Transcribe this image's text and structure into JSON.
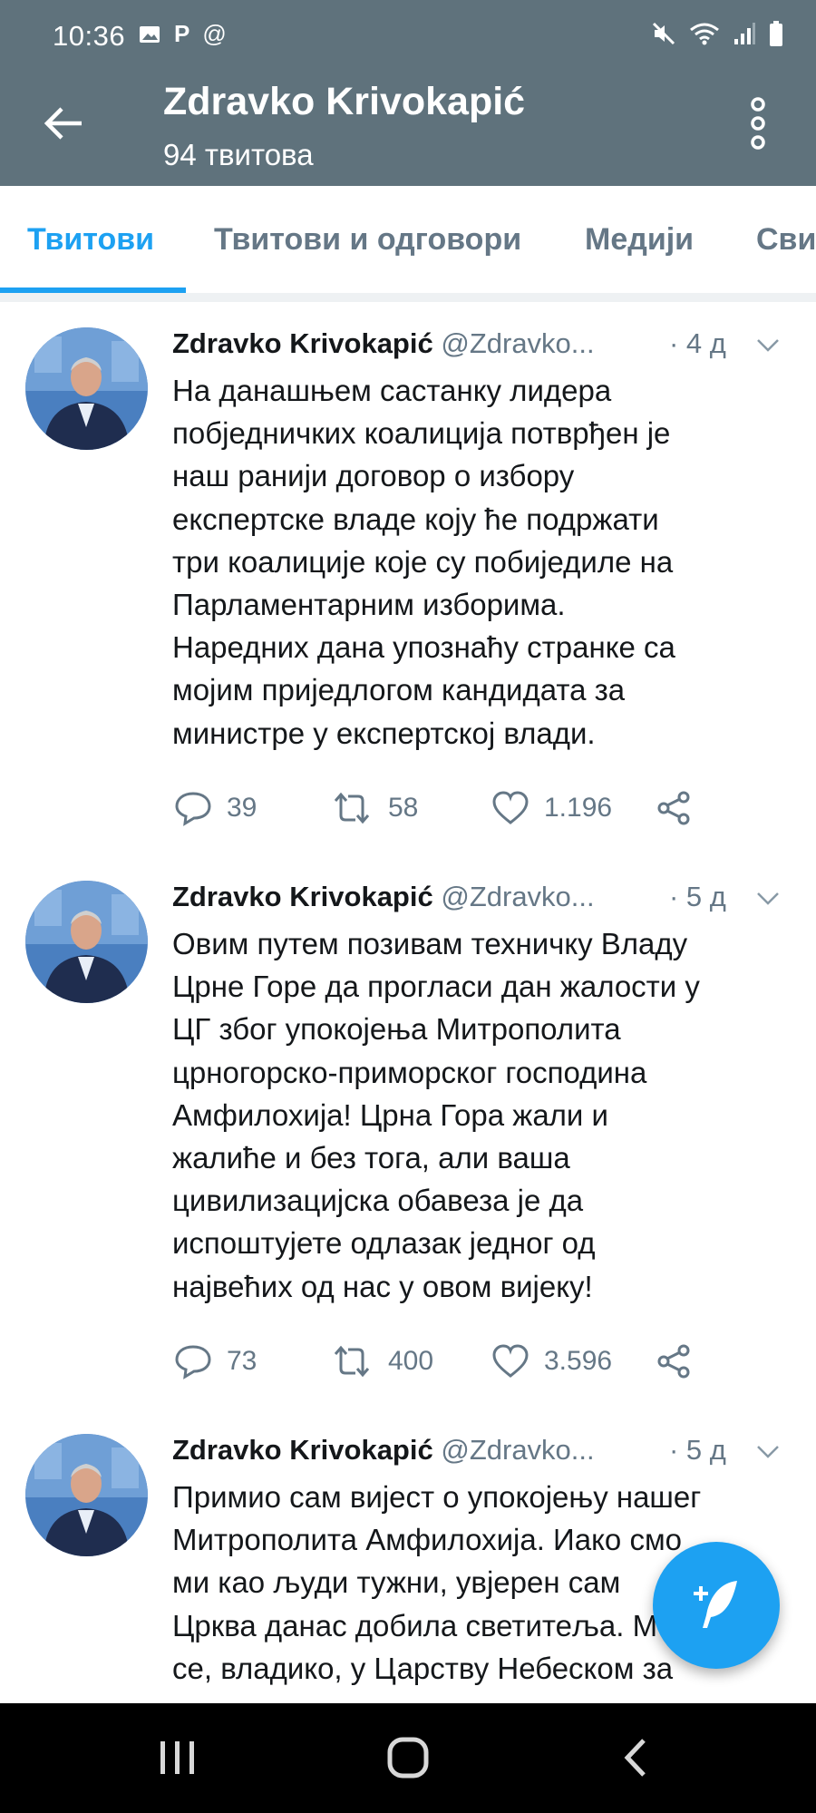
{
  "status_bar": {
    "time": "10:36",
    "left_icons": [
      "image-icon",
      "p-icon",
      "at-icon"
    ],
    "right_icons": [
      "mute-icon",
      "wifi-icon",
      "signal-icon",
      "battery-icon"
    ]
  },
  "header": {
    "title": "Zdravko Krivokapić",
    "subtitle": "94 твитова",
    "background_color": "#5f727c"
  },
  "tabs": [
    {
      "label": "Твитови",
      "active": true
    },
    {
      "label": "Твитови и одговори",
      "active": false
    },
    {
      "label": "Медији",
      "active": false
    },
    {
      "label": "Сви",
      "active": false
    }
  ],
  "accent_color": "#1da1f2",
  "tweets": [
    {
      "name": "Zdravko Krivokapić",
      "handle": "@Zdravko...",
      "time": "· 4 д",
      "lines": [
        "На данашњем састанку лидера",
        "побједничких коалиција потврђен је",
        "наш ранији договор о избору",
        "експертске владе коју ће подржати",
        "три коалиције које су побиједиле на",
        "Парламентарним изборима.",
        "Наредних дана упознаћу странке са",
        "мојим приједлогом кандидата за",
        "министре у експертској влади."
      ],
      "replies": "39",
      "retweets": "58",
      "likes": "1.196"
    },
    {
      "name": "Zdravko Krivokapić",
      "handle": "@Zdravko...",
      "time": "· 5 д",
      "lines": [
        "Овим путем позивам техничку Владу",
        "Црне Горе да прогласи дан жалости у",
        "ЦГ због упокојења Митрополита",
        "црногорско-приморског господина",
        "Амфилохија! Црна Гора жали и",
        "жалиће и без тога, али ваша",
        "цивилизацијска обавеза је да",
        "испоштујете одлазак једног од",
        "највећих од нас у овом вијеку!"
      ],
      "replies": "73",
      "retweets": "400",
      "likes": "3.596"
    },
    {
      "name": "Zdravko Krivokapić",
      "handle": "@Zdravko...",
      "time": "· 5 д",
      "lines": [
        "Примио сам вијест о упокојењу нашег",
        "Митрополита Амфилохија. Иако смо",
        "ми као људи тужни, увјерен сам",
        "Црква данас добила светитеља. Моли",
        "се, владико, у Царству Небеском за"
      ]
    }
  ],
  "fab_icon": "compose-tweet-icon",
  "nav_icons": [
    "recent-apps-icon",
    "home-icon",
    "back-nav-icon"
  ]
}
